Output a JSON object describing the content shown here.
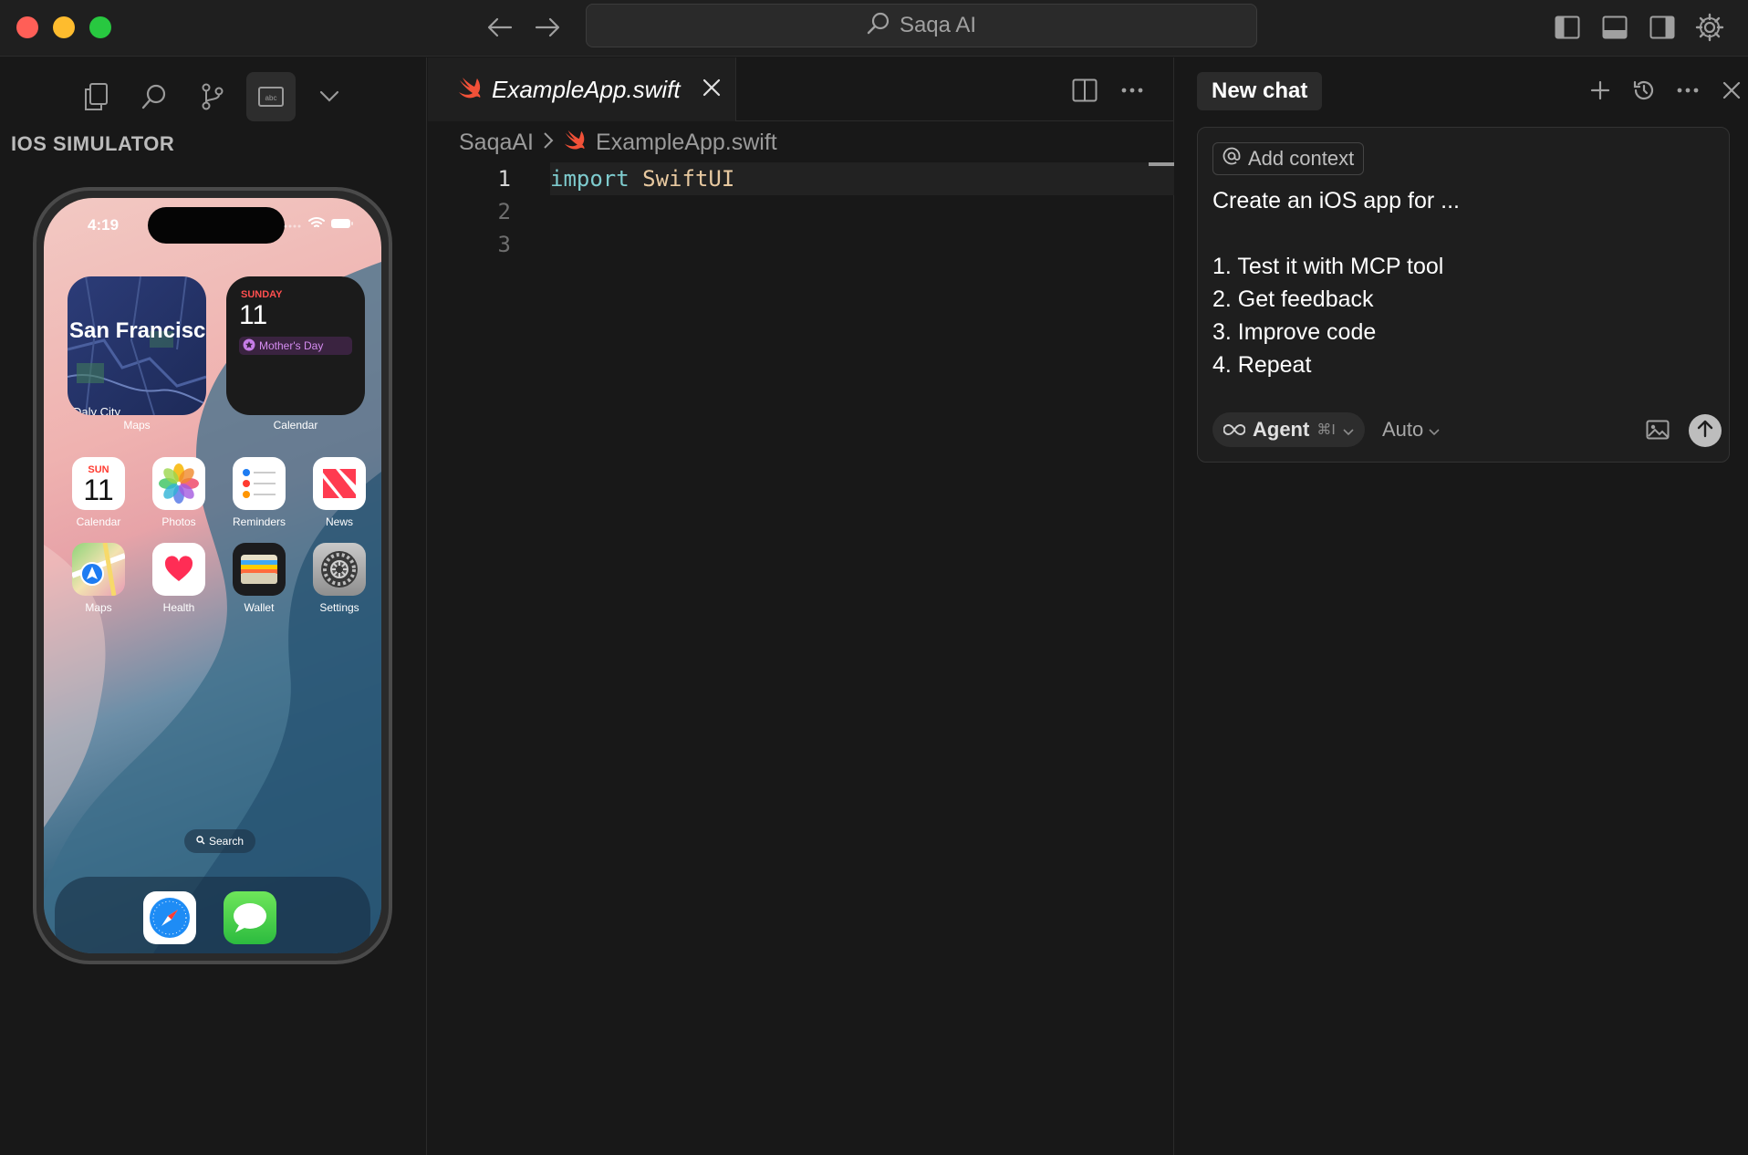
{
  "titlebar": {
    "search_text": "Saqa AI",
    "icons": [
      "arrow-left-icon",
      "arrow-right-icon",
      "search-icon",
      "toggle-left-sidebar-icon",
      "toggle-panel-icon",
      "toggle-right-sidebar-icon",
      "gear-icon"
    ]
  },
  "sidebar": {
    "title": "IOS SIMULATOR",
    "icons": [
      "files-icon",
      "search-icon",
      "source-control-icon",
      "simulator-icon",
      "chevron-down-icon"
    ]
  },
  "phone": {
    "time": "4:19",
    "maps_widget_title": "San Francisco",
    "maps_widget_sub": "Daly City",
    "maps_widget_label": "Maps",
    "calendar_widget_day": "SUNDAY",
    "calendar_widget_num": "11",
    "calendar_widget_event": "Mother's Day",
    "calendar_widget_label": "Calendar",
    "calendar_icon_day": "SUN",
    "calendar_icon_num": "11",
    "apps_row1": [
      "Calendar",
      "Photos",
      "Reminders",
      "News"
    ],
    "apps_row2": [
      "Maps",
      "Health",
      "Wallet",
      "Settings"
    ],
    "search_label": "Search",
    "dock": [
      "safari-icon",
      "messages-icon"
    ]
  },
  "editor": {
    "tab_title": "ExampleApp.swift",
    "breadcrumb_root": "SaqaAI",
    "breadcrumb_file": "ExampleApp.swift",
    "lines": [
      {
        "num": "1",
        "kw": "import",
        "ty": "SwiftUI"
      },
      {
        "num": "2",
        "kw": "",
        "ty": ""
      },
      {
        "num": "3",
        "kw": "",
        "ty": ""
      }
    ]
  },
  "chat": {
    "tab_title": "New chat",
    "add_context": "Add context",
    "prompt_lines": [
      "Create an iOS app for ...",
      "",
      "1. Test it with MCP tool",
      "2. Get feedback",
      "3. Improve code",
      "4. Repeat"
    ],
    "mode": "Agent",
    "mode_shortcut": "⌘I",
    "model": "Auto"
  },
  "colors": {
    "accent_swift": "#f05138",
    "keyword": "#7ecbce",
    "type": "#e8c9a0",
    "calendar_red": "#ff4f4f"
  }
}
